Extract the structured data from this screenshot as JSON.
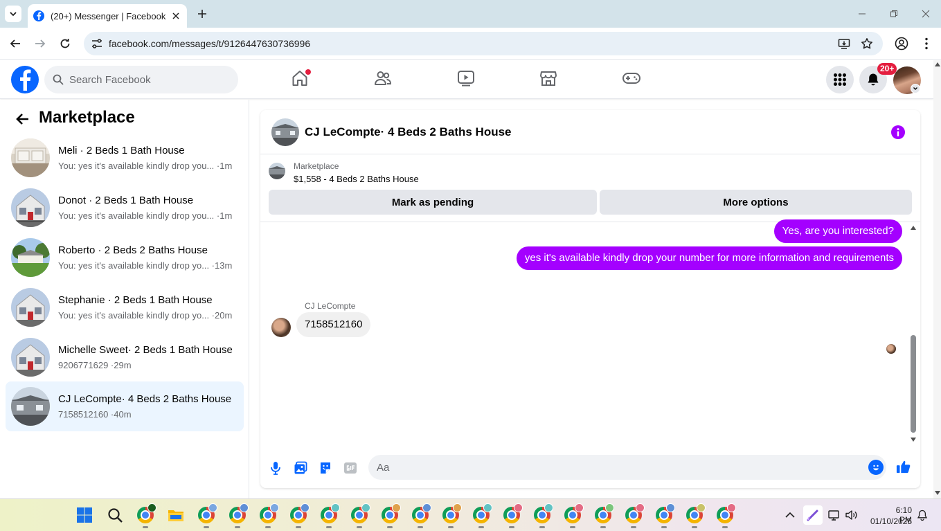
{
  "browser": {
    "tab_title": "(20+) Messenger | Facebook",
    "url": "facebook.com/messages/t/9126447630736996"
  },
  "header": {
    "search_placeholder": "Search Facebook",
    "notification_badge": "20+"
  },
  "sidebar": {
    "title": "Marketplace",
    "conversations": [
      {
        "name": "Meli · 2 Beds 1 Bath House",
        "preview": "You: yes it's available kindly drop you... ·1m",
        "active": false
      },
      {
        "name": "Donot · 2 Beds 1 Bath House",
        "preview": "You: yes it's available kindly drop you... ·1m",
        "active": false
      },
      {
        "name": "Roberto · 2 Beds 2 Baths House",
        "preview": "You: yes it's available kindly drop yo... ·13m",
        "active": false
      },
      {
        "name": "Stephanie · 2 Beds 1 Bath House",
        "preview": "You: yes it's available kindly drop yo... ·20m",
        "active": false
      },
      {
        "name": "Michelle Sweet· 2 Beds 1 Bath House",
        "preview": "9206771629 ·29m",
        "active": false
      },
      {
        "name": "CJ LeCompte· 4 Beds 2 Baths House",
        "preview": "7158512160 ·40m",
        "active": true
      }
    ]
  },
  "chat": {
    "title": "CJ LeCompte· 4 Beds 2 Baths House",
    "listing_source": "Marketplace",
    "listing_price": "$1,558 - 4 Beds 2 Baths House",
    "mark_pending_label": "Mark as pending",
    "more_options_label": "More options",
    "messages": [
      {
        "direction": "out",
        "text": "Yes, are you interested?"
      },
      {
        "direction": "out",
        "text": "yes it's available kindly drop your number for more information and requirements"
      },
      {
        "direction": "in",
        "sender": "CJ LeCompte",
        "text": "7158512160"
      }
    ],
    "composer_placeholder": "Aa"
  },
  "taskbar": {
    "time": "6:10 PM",
    "date": "01/10/2025"
  },
  "colors": {
    "facebook_blue": "#0866ff",
    "messenger_purple": "#a400ff",
    "badge_red": "#e41e3f",
    "active_row": "#ebf5ff"
  }
}
